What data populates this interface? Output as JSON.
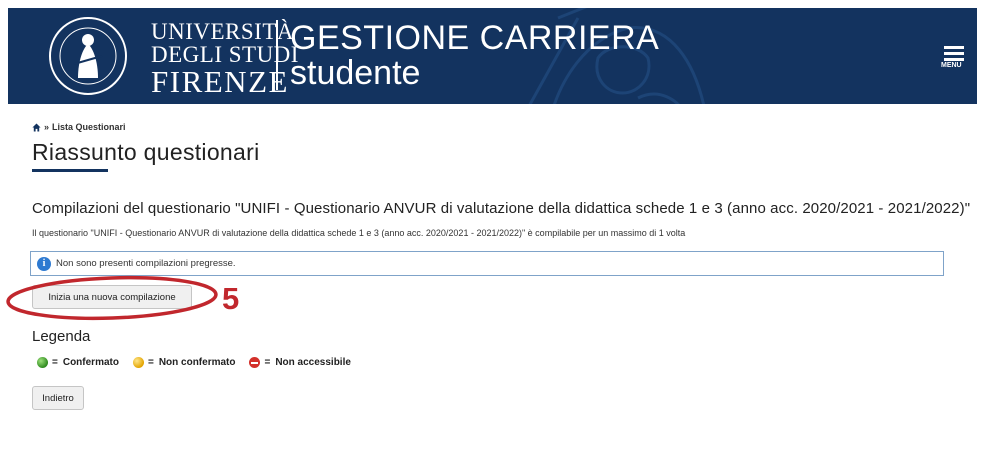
{
  "header": {
    "univ_line1": "UNIVERSITÀ",
    "univ_line2": "DEGLI STUDI",
    "univ_line3": "FIRENZE",
    "app_line1": "GESTIONE CARRIERA",
    "app_line2": "studente",
    "menu_label": "MENU",
    "bg_color": "#13335f"
  },
  "breadcrumb": {
    "separator": "»",
    "current": "Lista Questionari"
  },
  "page_title": "Riassunto questionari",
  "section_heading": "Compilazioni del questionario \"UNIFI - Questionario ANVUR di valutazione della didattica schede 1 e 3 (anno acc. 2020/2021 - 2021/2022)\"",
  "info_line": "Il questionario \"UNIFI - Questionario ANVUR di valutazione della didattica schede 1 e 3 (anno acc. 2020/2021 - 2021/2022)\"  è compilabile per un massimo di 1 volta",
  "notice": {
    "icon": "info-icon",
    "icon_glyph": "i",
    "text": "Non sono presenti compilazioni pregresse."
  },
  "buttons": {
    "new_compilation": "Inizia una nuova compilazione",
    "back": "Indietro"
  },
  "annotation": {
    "step_number": "5",
    "color": "#c1272d"
  },
  "legend": {
    "title": "Legenda",
    "eq": "=",
    "items": [
      {
        "label": "Confermato",
        "icon": "green-dot-icon"
      },
      {
        "label": "Non confermato",
        "icon": "yellow-dot-icon"
      },
      {
        "label": "Non accessibile",
        "icon": "red-no-entry-icon"
      }
    ]
  }
}
